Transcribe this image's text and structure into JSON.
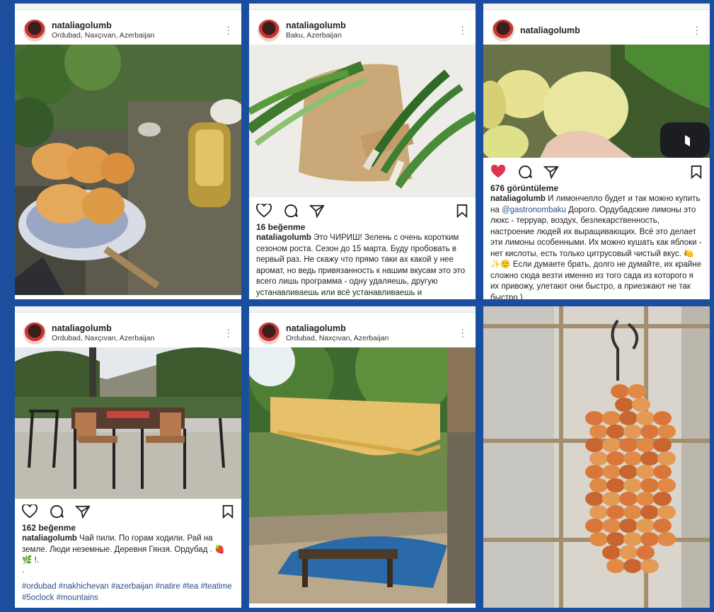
{
  "posts": [
    {
      "username": "nataliagolumb",
      "location": "Ordubad, Naxçıvan, Azerbaijan"
    },
    {
      "username": "nataliagolumb",
      "location": "Baku, Azerbaijan",
      "likes": "16 beğenme",
      "caption_user": "nataliagolumb",
      "caption": "Это ЧИРИШ! Зелень с очень коротким сезоном роста. Сезон до 15 марта. Буду пробовать в первый раз. Не скажу что прямо таки ах какой у нее аромат, но ведь привязанность к нашим вкусам это это всего лишь программа - одну удаляешь, другую устанавливаешь или всё устанавливаешь и"
    },
    {
      "username": "nataliagolumb",
      "views": "676 görüntüleme",
      "caption_user": "nataliagolumb",
      "caption_a": "И лимончелло будет и так можно купить на ",
      "mention": "@gastronombaku",
      "caption_b": " Дорого. Ордубадские лимоны это люкс - терруар, воздух, безлекарственность, настроение людей их выращивающих. Всё это делает эти лимоны особенными. Их можно кушать как яблоки - нет кислоты, есть только цитрусовый чистый вкус. 🍋 ✨🙂 Если думаете брать, долго не думайте, их крайне сложно сюда везти именно из того сада из которого я их привожу, улетают они быстро, а приезжают не так быстро )"
    },
    {
      "username": "nataliagolumb",
      "location": "Ordubad, Naxçıvan, Azerbaijan",
      "likes": "162 beğenme",
      "caption_user": "nataliagolumb",
      "caption": "Чай пили. По горам ходили. Рай на земле. Люди неземные. Деревня Гянзя. Ордубад . 🍓 🌿 !.",
      "dot": ".",
      "hashtags": "#ordubad #nakhichevan #azerbaijan #natire #tea #teatime #5oclock #mountains"
    },
    {
      "username": "nataliagolumb",
      "location": "Ordubad, Naxçıvan, Azerbaijan"
    }
  ],
  "colors": {
    "frame": "#1a4fa0",
    "heart": "#e0334d",
    "link": "#2b4f86"
  }
}
